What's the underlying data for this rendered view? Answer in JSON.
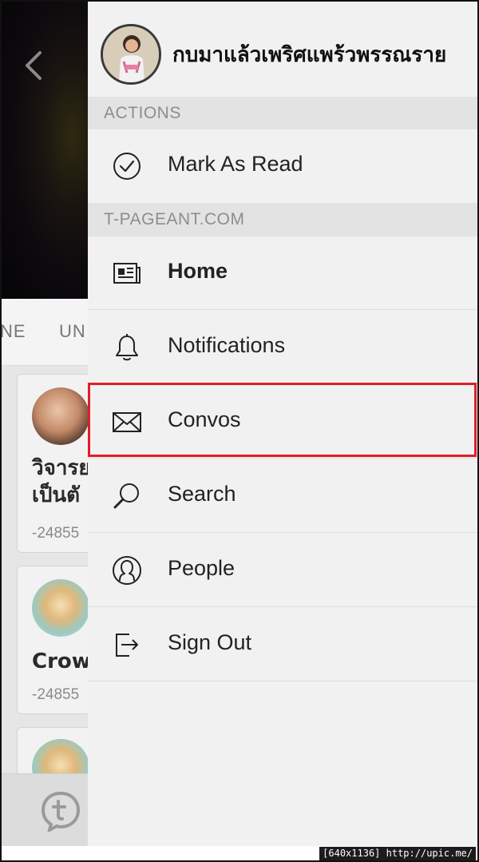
{
  "background_app": {
    "tabs": [
      "NE",
      "UN"
    ],
    "cards": [
      {
        "title_lines": [
          "วิจารย",
          "เป็นตั"
        ],
        "meta": "-24855"
      },
      {
        "title_lines": [
          "Crowr"
        ],
        "meta": "-24855"
      }
    ]
  },
  "drawer": {
    "profile": {
      "name": "กบมาแล้วเพริศแพร้วพรรณราย"
    },
    "sections": [
      {
        "header": "ACTIONS",
        "items": [
          {
            "label": "Mark As Read",
            "icon": "check-circle-icon"
          }
        ]
      },
      {
        "header": "T-PAGEANT.COM",
        "items": [
          {
            "label": "Home",
            "icon": "newspaper-icon",
            "active": true
          },
          {
            "label": "Notifications",
            "icon": "bell-icon"
          },
          {
            "label": "Convos",
            "icon": "envelope-icon",
            "highlighted": true
          },
          {
            "label": "Search",
            "icon": "search-icon"
          },
          {
            "label": "People",
            "icon": "person-circle-icon"
          },
          {
            "label": "Sign Out",
            "icon": "sign-out-icon"
          }
        ]
      }
    ]
  },
  "colors": {
    "highlight_border": "#e01e28",
    "drawer_bg": "#f1f1f1",
    "section_bg": "#e3e3e3"
  },
  "watermark": "[640x1136] http://upic.me/"
}
